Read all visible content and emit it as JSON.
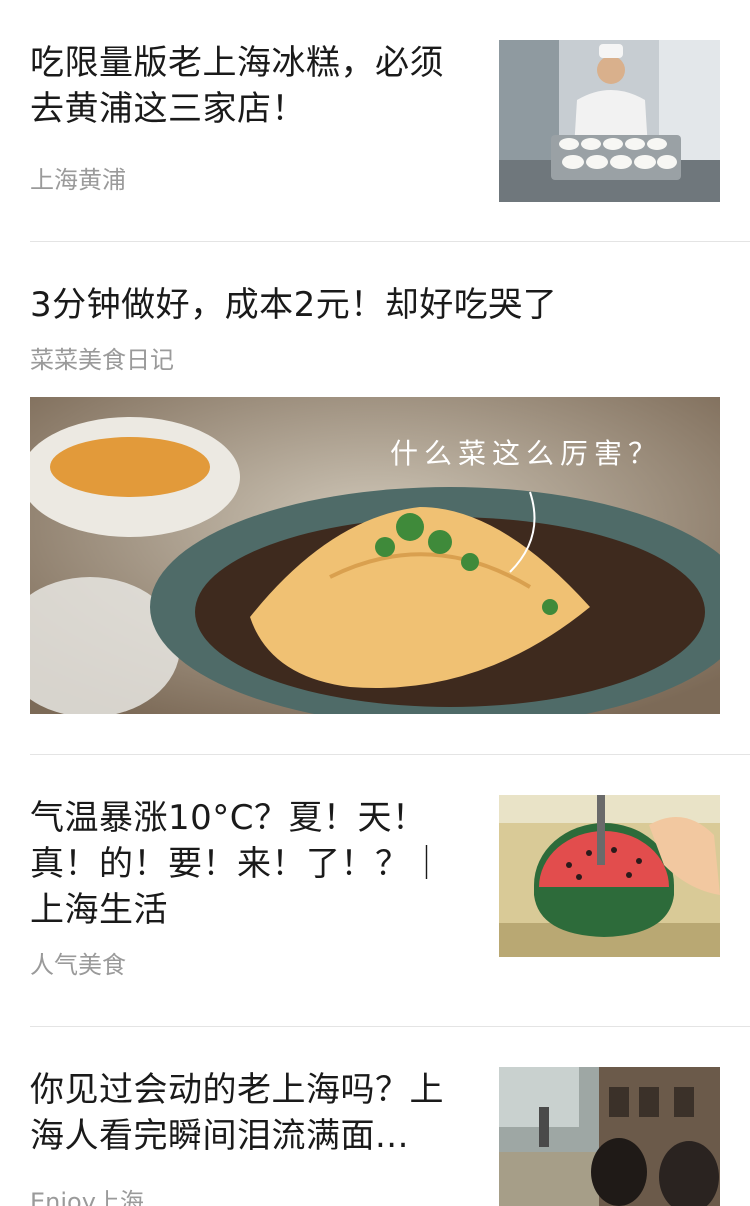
{
  "feed": {
    "articles": [
      {
        "title_line1": "吃限量版老上海冰糕，必须",
        "title_line2": "去黄浦这三家店！",
        "source": "上海黄浦",
        "thumb_icon": "chef-with-tray-of-ice-cakes-image"
      },
      {
        "title": "3分钟做好，成本2元！却好吃哭了",
        "source": "菜菜美食日记",
        "cover_caption": "什么菜这么厉害？",
        "cover_icon": "jelly-dish-with-cilantro-image"
      },
      {
        "title_line1": "气温暴涨10°C？夏！天！",
        "title_line2": "真！的！要！来！了！？｜",
        "title_line3": "上海生活",
        "source": "人气美食",
        "thumb_icon": "cutting-watermelon-image"
      },
      {
        "title_line1": "你见过会动的老上海吗？上",
        "title_line2": "海人看完瞬间泪流满面...",
        "source": "Enjoy上海",
        "thumb_icon": "old-shanghai-street-image"
      }
    ]
  },
  "colors": {
    "title": "#1a1a1a",
    "source": "#9a9a9a",
    "divider": "#e4e4e4"
  }
}
